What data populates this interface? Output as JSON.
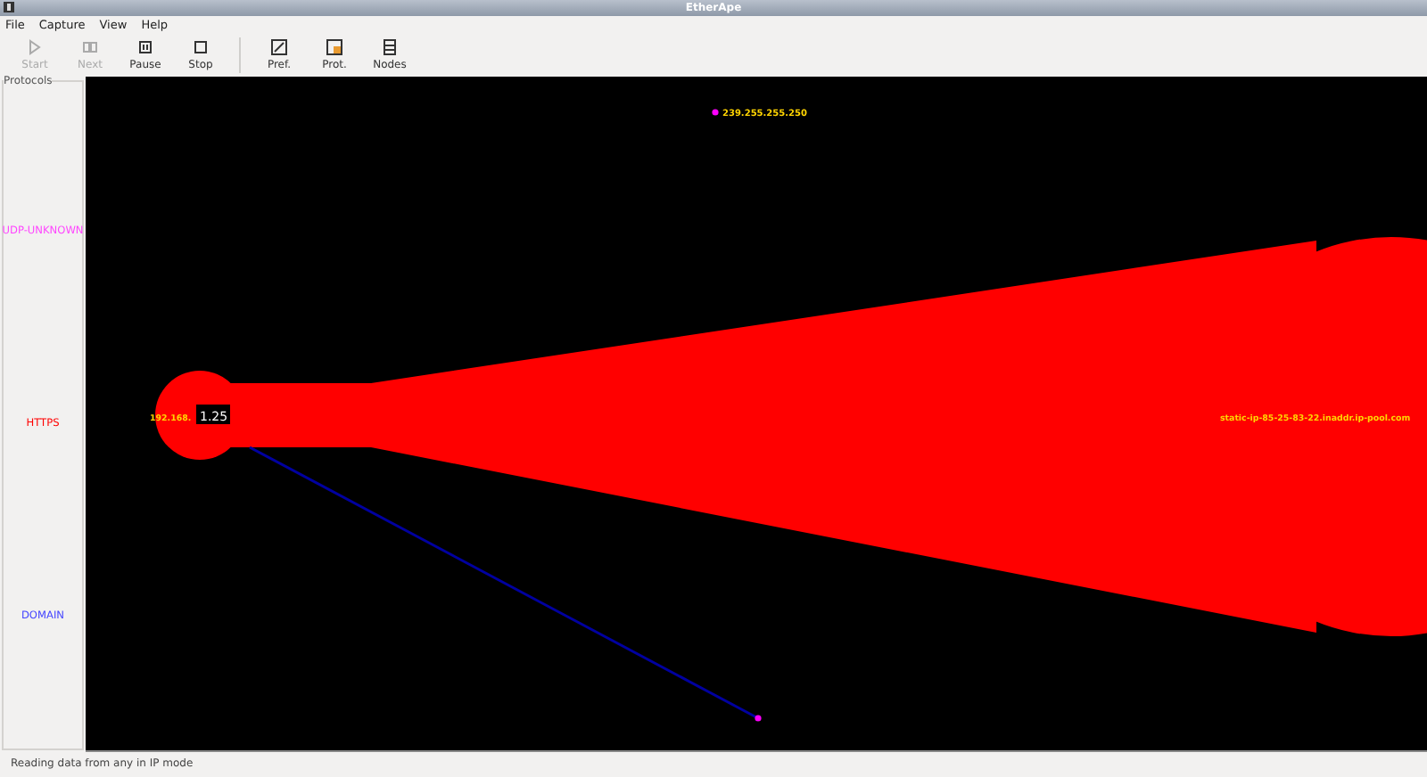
{
  "window": {
    "title": "EtherApe"
  },
  "menu": [
    "File",
    "Capture",
    "View",
    "Help"
  ],
  "toolbar": [
    {
      "label": "Start",
      "disabled": true
    },
    {
      "label": "Next",
      "disabled": true
    },
    {
      "label": "Pause",
      "disabled": false
    },
    {
      "label": "Stop",
      "disabled": false
    },
    {
      "label": "Pref.",
      "disabled": false
    },
    {
      "label": "Prot.",
      "disabled": false
    },
    {
      "label": "Nodes",
      "disabled": false
    }
  ],
  "protocols": {
    "title": "Protocols",
    "items": [
      {
        "name": "UDP-UNKNOWN",
        "color": "#ff44ff"
      },
      {
        "name": "HTTPS",
        "color": "#ff0000"
      },
      {
        "name": "DOMAIN",
        "color": "#4444ff"
      }
    ]
  },
  "graph": {
    "nodes": [
      {
        "label": "192.168.",
        "traffic": "1.25"
      },
      {
        "label": "239.255.255.250"
      },
      {
        "label": "static-ip-85-25-83-22.inaddr.ip-pool.com"
      }
    ]
  },
  "status_bar": "Reading data from any in IP mode"
}
